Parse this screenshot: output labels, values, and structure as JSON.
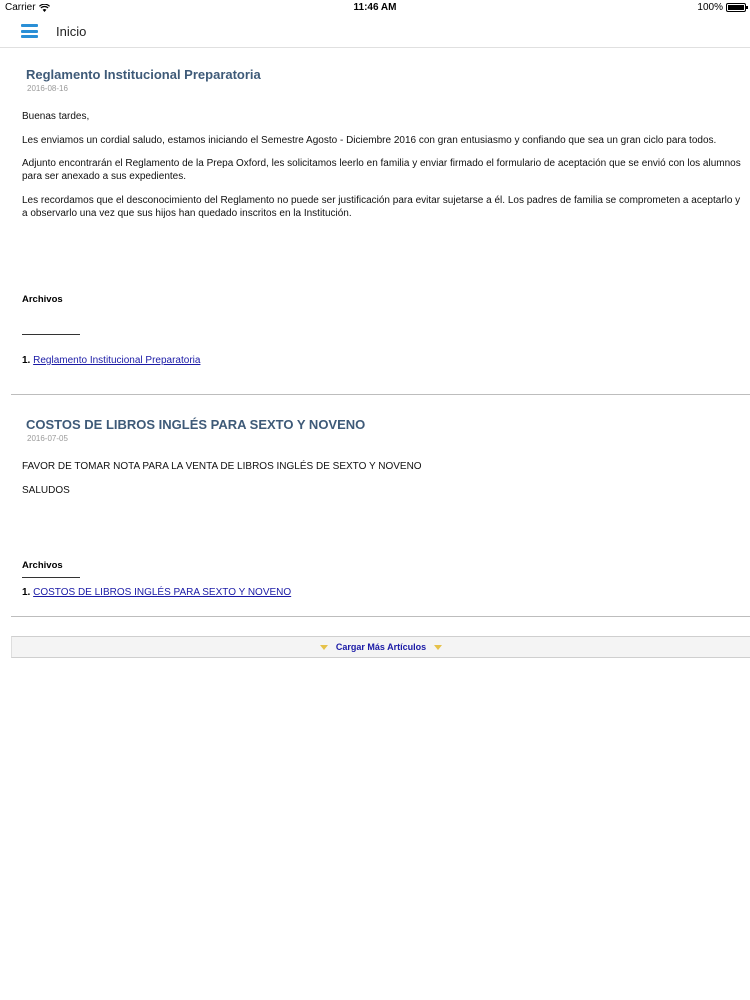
{
  "status_bar": {
    "carrier": "Carrier",
    "time": "11:46 AM",
    "battery": "100%"
  },
  "nav": {
    "title": "Inicio"
  },
  "articles": [
    {
      "title": "Reglamento Institucional Preparatoria",
      "date": "2016-08-16",
      "paragraphs": [
        "Buenas tardes,",
        "Les enviamos un cordial saludo, estamos iniciando el Semestre Agosto - Diciembre 2016 con gran entusiasmo y confiando que sea un gran ciclo para todos.",
        "Adjunto encontrarán el Reglamento de la Prepa Oxford, les solicitamos leerlo en familia y enviar firmado el formulario de aceptación que se envió con los alumnos para ser anexado a sus expedientes.",
        "Les recordamos que el desconocimiento del Reglamento no puede ser justificación para evitar sujetarse a él. Los padres de familia se comprometen a aceptarlo y a observarlo una vez que sus hijos han quedado inscritos en la Institución."
      ],
      "files_heading": "Archivos",
      "files": [
        {
          "number": "1.",
          "label": "Reglamento Institucional Preparatoria"
        }
      ]
    },
    {
      "title": "COSTOS DE LIBROS INGLÉS PARA SEXTO Y NOVENO",
      "date": "2016-07-05",
      "paragraphs": [
        "FAVOR DE TOMAR NOTA PARA LA VENTA DE LIBROS INGLÉS DE SEXTO Y NOVENO",
        "SALUDOS"
      ],
      "files_heading": "Archivos",
      "files": [
        {
          "number": "1.",
          "label": "COSTOS DE LIBROS INGLÉS PARA SEXTO Y NOVENO"
        }
      ]
    }
  ],
  "load_more": {
    "label": "Cargar Más Artículos"
  },
  "colors": {
    "menu_icon": "#2a8fd6",
    "title": "#3e5a78",
    "link": "#1a1aa6",
    "arrow": "#e6c24a"
  }
}
